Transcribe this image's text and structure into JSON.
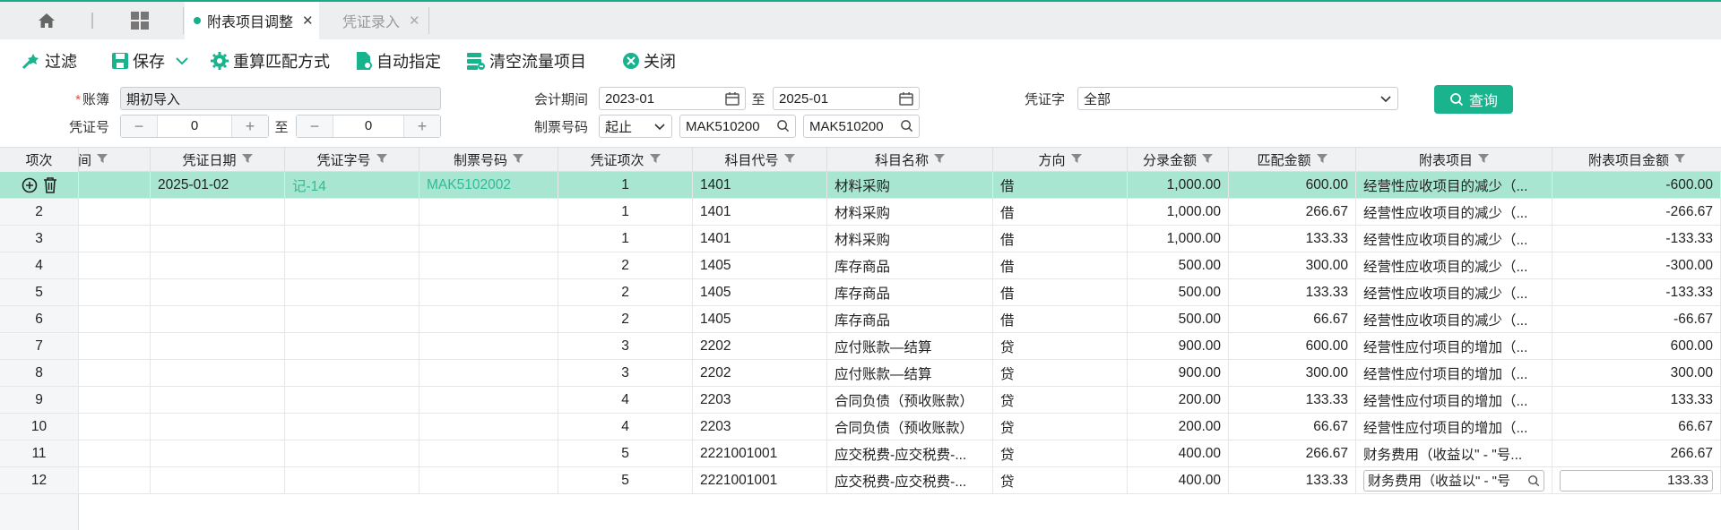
{
  "tabs": {
    "active_label": "附表项目调整",
    "inactive_label": "凭证录入",
    "close_glyph": "✕"
  },
  "toolbar": {
    "filter_label": "过滤",
    "save_label": "保存",
    "recalc_label": "重算匹配方式",
    "auto_assign_label": "自动指定",
    "clear_flow_label": "清空流量项目",
    "close_label": "关闭"
  },
  "form": {
    "ledger_required_mark": "*",
    "ledger_label": "账簿",
    "ledger_value": "期初导入",
    "period_label": "会计期间",
    "period_from": "2023-01",
    "to_label": "至",
    "period_to": "2025-01",
    "voucher_word_label": "凭证字",
    "voucher_word_value": "全部",
    "query_label": "查询",
    "voucher_no_label": "凭证号",
    "voucher_no_from": "0",
    "voucher_no_to": "0",
    "invoice_no_label": "制票号码",
    "invoice_mode": "起止",
    "invoice_from": "MAK510200",
    "invoice_to": "MAK510200"
  },
  "table": {
    "headers": {
      "index": "项次",
      "period": "期间",
      "date": "凭证日期",
      "voucher_word_no": "凭证字号",
      "invoice_no": "制票号码",
      "voucher_item": "凭证项次",
      "account_code": "科目代号",
      "account_name": "科目名称",
      "direction": "方向",
      "entry_amount": "分录金额",
      "match_amount": "匹配金额",
      "schedule_item": "附表项目",
      "schedule_amount": "附表项目金额"
    },
    "rows": [
      {
        "idx": "",
        "date": "2025-01-02",
        "vno": "记-14",
        "inv": "MAK5102002",
        "item": "1",
        "code": "1401",
        "name": "材料采购",
        "dir": "借",
        "amt": "1,000.00",
        "match": "600.00",
        "sched": "经营性应收项目的减少（...",
        "samt": "-600.00"
      },
      {
        "idx": "2",
        "date": "",
        "vno": "",
        "inv": "",
        "item": "1",
        "code": "1401",
        "name": "材料采购",
        "dir": "借",
        "amt": "1,000.00",
        "match": "266.67",
        "sched": "经营性应收项目的减少（...",
        "samt": "-266.67"
      },
      {
        "idx": "3",
        "date": "",
        "vno": "",
        "inv": "",
        "item": "1",
        "code": "1401",
        "name": "材料采购",
        "dir": "借",
        "amt": "1,000.00",
        "match": "133.33",
        "sched": "经营性应收项目的减少（...",
        "samt": "-133.33"
      },
      {
        "idx": "4",
        "date": "",
        "vno": "",
        "inv": "",
        "item": "2",
        "code": "1405",
        "name": "库存商品",
        "dir": "借",
        "amt": "500.00",
        "match": "300.00",
        "sched": "经营性应收项目的减少（...",
        "samt": "-300.00"
      },
      {
        "idx": "5",
        "date": "",
        "vno": "",
        "inv": "",
        "item": "2",
        "code": "1405",
        "name": "库存商品",
        "dir": "借",
        "amt": "500.00",
        "match": "133.33",
        "sched": "经营性应收项目的减少（...",
        "samt": "-133.33"
      },
      {
        "idx": "6",
        "date": "",
        "vno": "",
        "inv": "",
        "item": "2",
        "code": "1405",
        "name": "库存商品",
        "dir": "借",
        "amt": "500.00",
        "match": "66.67",
        "sched": "经营性应收项目的减少（...",
        "samt": "-66.67"
      },
      {
        "idx": "7",
        "date": "",
        "vno": "",
        "inv": "",
        "item": "3",
        "code": "2202",
        "name": "应付账款—结算",
        "dir": "贷",
        "amt": "900.00",
        "match": "600.00",
        "sched": "经营性应付项目的增加（...",
        "samt": "600.00"
      },
      {
        "idx": "8",
        "date": "",
        "vno": "",
        "inv": "",
        "item": "3",
        "code": "2202",
        "name": "应付账款—结算",
        "dir": "贷",
        "amt": "900.00",
        "match": "300.00",
        "sched": "经营性应付项目的增加（...",
        "samt": "300.00"
      },
      {
        "idx": "9",
        "date": "",
        "vno": "",
        "inv": "",
        "item": "4",
        "code": "2203",
        "name": "合同负债（预收账款）",
        "dir": "贷",
        "amt": "200.00",
        "match": "133.33",
        "sched": "经营性应付项目的增加（...",
        "samt": "133.33"
      },
      {
        "idx": "10",
        "date": "",
        "vno": "",
        "inv": "",
        "item": "4",
        "code": "2203",
        "name": "合同负债（预收账款）",
        "dir": "贷",
        "amt": "200.00",
        "match": "66.67",
        "sched": "经营性应付项目的增加（...",
        "samt": "66.67"
      },
      {
        "idx": "11",
        "date": "",
        "vno": "",
        "inv": "",
        "item": "5",
        "code": "2221001001",
        "name": "应交税费-应交税费-...",
        "dir": "贷",
        "amt": "400.00",
        "match": "266.67",
        "sched": "财务费用（收益以\" - \"号...",
        "samt": "266.67"
      },
      {
        "idx": "12",
        "date": "",
        "vno": "",
        "inv": "",
        "item": "5",
        "code": "2221001001",
        "name": "应交税费-应交税费-...",
        "dir": "贷",
        "amt": "400.00",
        "match": "133.33",
        "sched": "财务费用（收益以\" - \"号",
        "samt": "133.33"
      }
    ]
  },
  "colors": {
    "accent": "#19b38d",
    "selected_row": "#a8e6d2",
    "link": "#2dbd96"
  }
}
